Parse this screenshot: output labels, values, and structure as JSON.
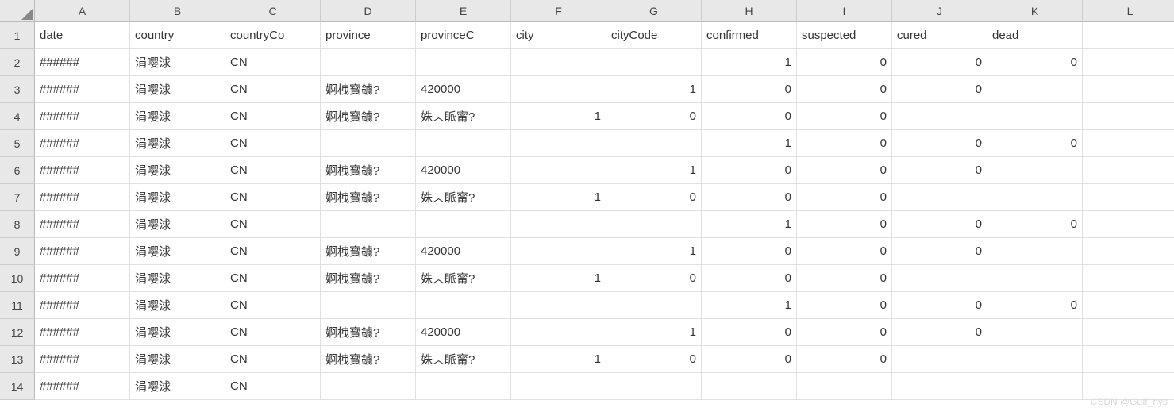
{
  "columns": [
    "A",
    "B",
    "C",
    "D",
    "E",
    "F",
    "G",
    "H",
    "I",
    "J",
    "K",
    "L"
  ],
  "headers": [
    "date",
    "country",
    "countryCo",
    "province",
    "provinceC",
    "city",
    "cityCode",
    "confirmed",
    "suspected",
    "cured",
    "dead",
    ""
  ],
  "numericCols": [
    5,
    6,
    7,
    8,
    9,
    10
  ],
  "rows": [
    [
      "######",
      "涓嘤浗",
      "CN",
      "",
      "",
      "",
      "",
      "1",
      "0",
      "0",
      "0",
      ""
    ],
    [
      "######",
      "涓嘤浗",
      "CN",
      "婀栧寳鐪?",
      "420000",
      "",
      "1",
      "0",
      "0",
      "0",
      "",
      ""
    ],
    [
      "######",
      "涓嘤浗",
      "CN",
      "婀栧寳鐪?",
      "姝︿眽甯?",
      "1",
      "0",
      "0",
      "0",
      "",
      "",
      ""
    ],
    [
      "######",
      "涓嘤浗",
      "CN",
      "",
      "",
      "",
      "",
      "1",
      "0",
      "0",
      "0",
      ""
    ],
    [
      "######",
      "涓嘤浗",
      "CN",
      "婀栧寳鐪?",
      "420000",
      "",
      "1",
      "0",
      "0",
      "0",
      "",
      ""
    ],
    [
      "######",
      "涓嘤浗",
      "CN",
      "婀栧寳鐪?",
      "姝︿眽甯?",
      "1",
      "0",
      "0",
      "0",
      "",
      "",
      ""
    ],
    [
      "######",
      "涓嘤浗",
      "CN",
      "",
      "",
      "",
      "",
      "1",
      "0",
      "0",
      "0",
      ""
    ],
    [
      "######",
      "涓嘤浗",
      "CN",
      "婀栧寳鐪?",
      "420000",
      "",
      "1",
      "0",
      "0",
      "0",
      "",
      ""
    ],
    [
      "######",
      "涓嘤浗",
      "CN",
      "婀栧寳鐪?",
      "姝︿眽甯?",
      "1",
      "0",
      "0",
      "0",
      "",
      "",
      ""
    ],
    [
      "######",
      "涓嘤浗",
      "CN",
      "",
      "",
      "",
      "",
      "1",
      "0",
      "0",
      "0",
      ""
    ],
    [
      "######",
      "涓嘤浗",
      "CN",
      "婀栧寳鐪?",
      "420000",
      "",
      "1",
      "0",
      "0",
      "0",
      "",
      ""
    ],
    [
      "######",
      "涓嘤浗",
      "CN",
      "婀栧寳鐪?",
      "姝︿眽甯?",
      "1",
      "0",
      "0",
      "0",
      "",
      "",
      ""
    ],
    [
      "######",
      "涓嘤浗",
      "CN",
      "",
      "",
      "",
      "",
      "",
      "",
      "",
      "",
      ""
    ]
  ],
  "watermark": "CSDN @Guff_hys"
}
